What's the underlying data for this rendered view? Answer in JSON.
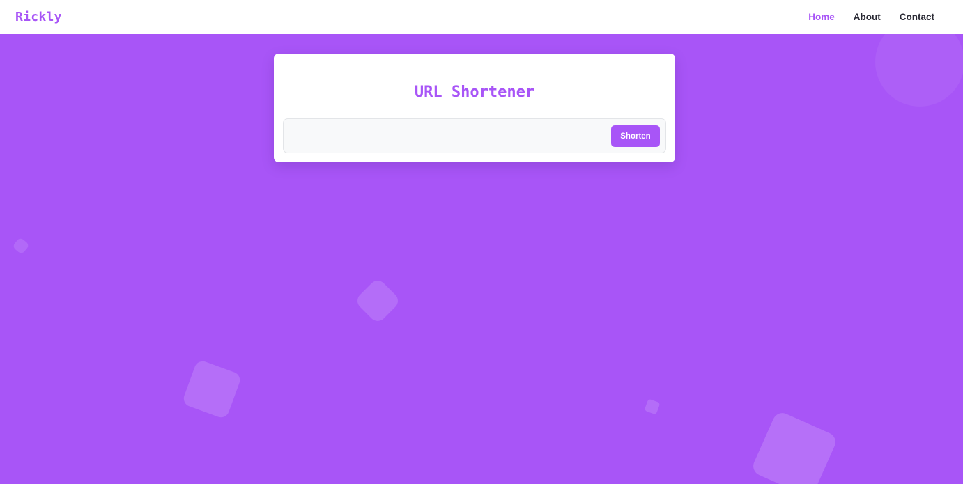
{
  "navbar": {
    "brand": "Rickly",
    "links": [
      {
        "label": "Home",
        "active": true
      },
      {
        "label": "About",
        "active": false
      },
      {
        "label": "Contact",
        "active": false
      }
    ]
  },
  "main": {
    "title": "URL Shortener",
    "url_input": {
      "value": "",
      "placeholder": ""
    },
    "shorten_label": "Shorten"
  },
  "colors": {
    "accent": "#a855f7",
    "background": "#a855f7",
    "navbar_bg": "#ffffff",
    "card_bg": "#ffffff",
    "input_bg": "#f8f9fa"
  }
}
